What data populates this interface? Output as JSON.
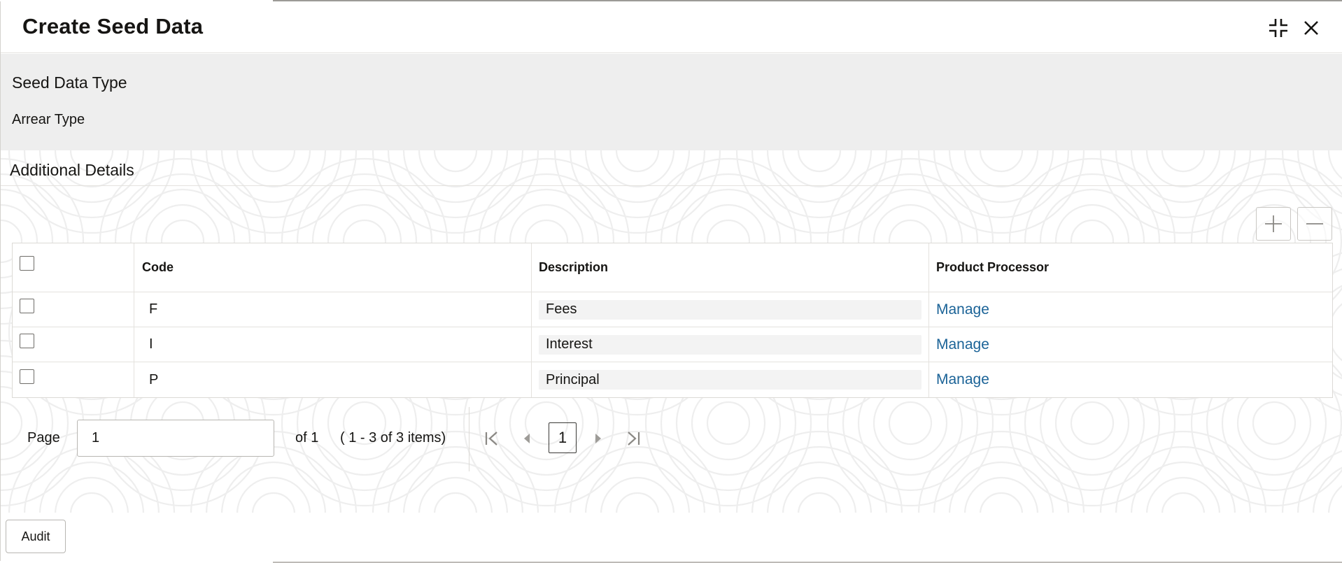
{
  "modal": {
    "title": "Create Seed Data"
  },
  "seed_data_type": {
    "label": "Seed Data Type",
    "value": "Arrear Type"
  },
  "additional_details": {
    "title": "Additional Details",
    "columns": {
      "code": "Code",
      "description": "Description",
      "product_processor": "Product Processor"
    },
    "rows": [
      {
        "code": "F",
        "description": "Fees",
        "product_processor": "Manage"
      },
      {
        "code": "I",
        "description": "Interest",
        "product_processor": "Manage"
      },
      {
        "code": "P",
        "description": "Principal",
        "product_processor": "Manage"
      }
    ]
  },
  "pagination": {
    "page_label": "Page",
    "page_value": "1",
    "of_text": "of 1",
    "items_text": "( 1 - 3 of 3 items)",
    "current_page": "1"
  },
  "footer": {
    "audit_label": "Audit"
  },
  "icons": {
    "minimize": "compress-icon",
    "close": "close-icon",
    "add": "plus-icon",
    "remove": "minus-icon",
    "first": "first-page-icon",
    "prev": "prev-page-icon",
    "next": "next-page-icon",
    "last": "last-page-icon"
  },
  "colors": {
    "link": "#1b6397",
    "panel_bg": "#eeeeee",
    "text": "#161513"
  }
}
